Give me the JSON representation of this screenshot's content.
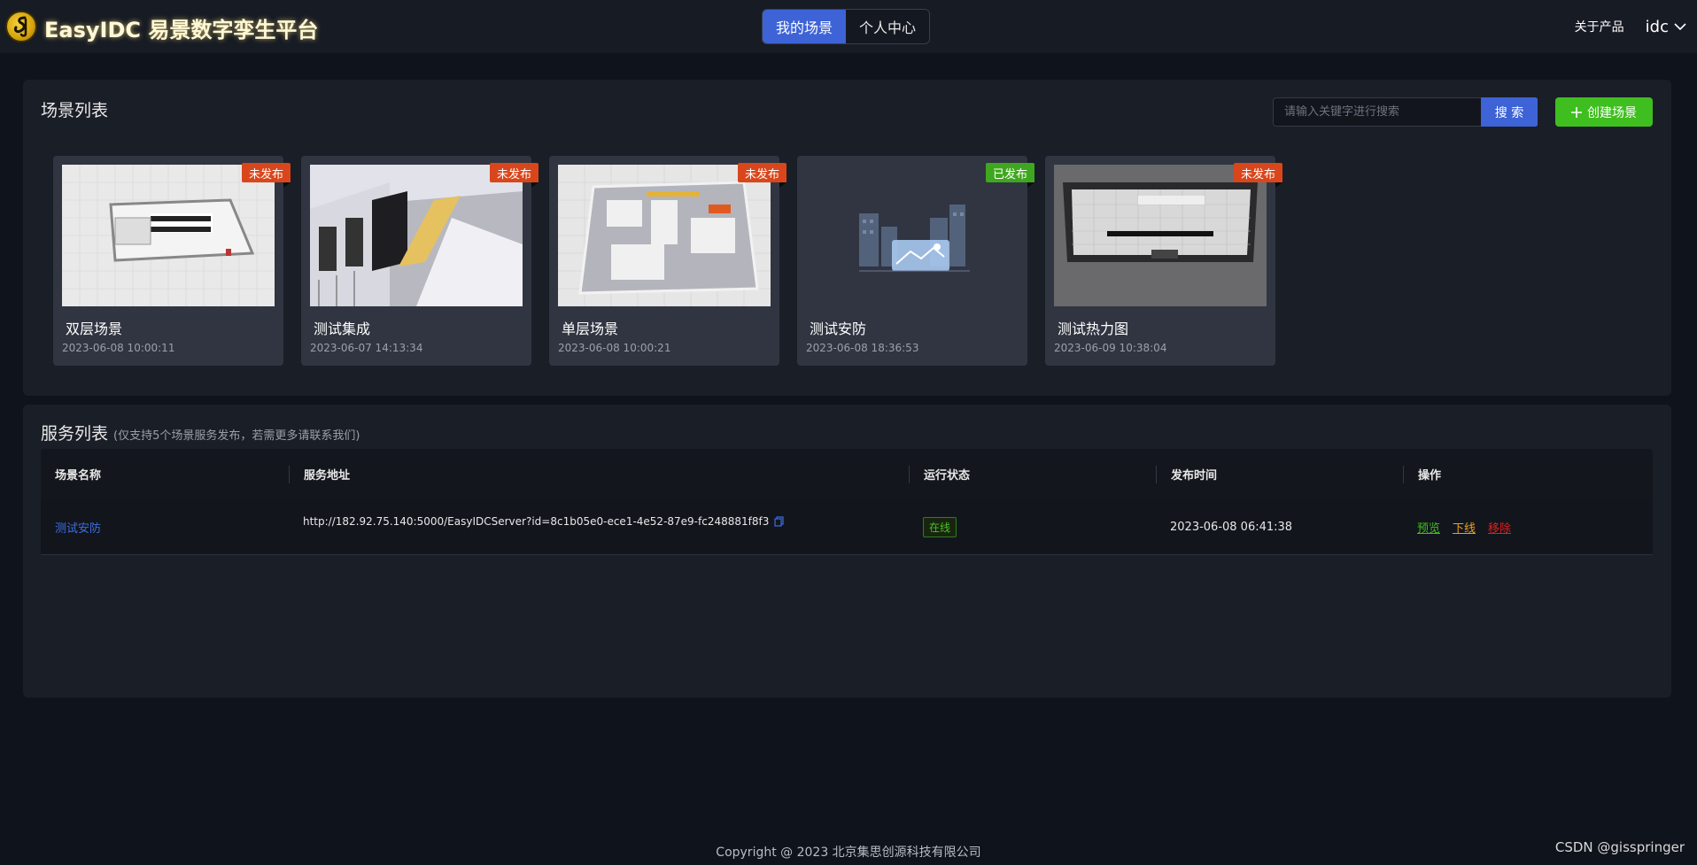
{
  "header": {
    "app_title": "EasyIDC 易景数字孪生平台",
    "tabs": [
      {
        "label": "我的场景",
        "active": true
      },
      {
        "label": "个人中心",
        "active": false
      }
    ],
    "about": "关于产品",
    "user": "idc"
  },
  "scene_panel": {
    "title": "场景列表",
    "search_placeholder": "请输入关键字进行搜索",
    "search_button": "搜 索",
    "create_button": "创建场景",
    "cards": [
      {
        "name": "双层场景",
        "date": "2023-06-08 10:00:11",
        "badge": "未发布",
        "published": false
      },
      {
        "name": "测试集成",
        "date": "2023-06-07 14:13:34",
        "badge": "未发布",
        "published": false
      },
      {
        "name": "单层场景",
        "date": "2023-06-08 10:00:21",
        "badge": "未发布",
        "published": false
      },
      {
        "name": "测试安防",
        "date": "2023-06-08 18:36:53",
        "badge": "已发布",
        "published": true
      },
      {
        "name": "测试热力图",
        "date": "2023-06-09 10:38:04",
        "badge": "未发布",
        "published": false
      }
    ]
  },
  "service_panel": {
    "title": "服务列表",
    "subtitle": "(仅支持5个场景服务发布，若需更多请联系我们)",
    "columns": [
      "场景名称",
      "服务地址",
      "运行状态",
      "发布时间",
      "操作"
    ],
    "rows": [
      {
        "scene": "测试安防",
        "address": "http://182.92.75.140:5000/EasyIDCServer?id=8c1b05e0-ece1-4e52-87e9-fc248881f8f3",
        "status": "在线",
        "time": "2023-06-08 06:41:38",
        "ops": {
          "preview": "预览",
          "offline": "下线",
          "remove": "移除"
        }
      }
    ]
  },
  "footer": "Copyright @ 2023 北京集思创源科技有限公司",
  "watermark": "CSDN @gisspringer",
  "colors": {
    "accent_blue": "#3d63d6",
    "create_green": "#3fbf1f",
    "unpublished": "#d9461c",
    "published": "#3fa71f"
  }
}
